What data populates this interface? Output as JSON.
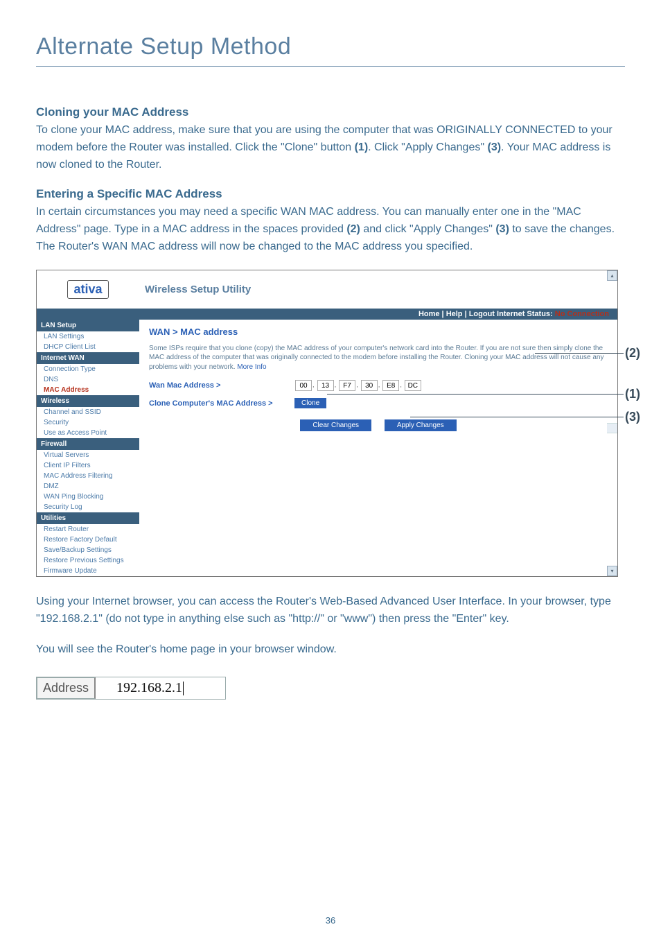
{
  "page": {
    "title": "Alternate Setup Method",
    "number": "36"
  },
  "section1": {
    "heading": "Cloning your MAC Address",
    "body_part1": "To clone your MAC address, make sure that you are using the computer that was ORIGINALLY CONNECTED to your modem before the Router was installed. Click the \"Clone\" button ",
    "bold1": "(1)",
    "body_part2": ". Click \"Apply Changes\" ",
    "bold2": "(3)",
    "body_part3": ". Your MAC address is now cloned to the Router."
  },
  "section2": {
    "heading": "Entering a Specific MAC Address",
    "body_part1": "In certain circumstances you may need a specific WAN MAC address. You can manually enter one in the \"MAC Address\" page. Type in a MAC address in the spaces provided ",
    "bold1": "(2)",
    "body_part2": " and click \"Apply Changes\" ",
    "bold2": "(3)",
    "body_part3": " to save the changes. The Router's WAN MAC address will now be changed to the MAC address you specified."
  },
  "router": {
    "logo": "ativa",
    "utility_title": "Wireless Setup Utility",
    "status_links": "Home | Help | Logout   Internet Status:",
    "status_value": "No Connection",
    "sidebar": {
      "lan_setup": {
        "cat": "LAN Setup",
        "items": [
          "LAN Settings",
          "DHCP Client List"
        ]
      },
      "internet_wan": {
        "cat": "Internet WAN",
        "items": [
          "Connection Type",
          "DNS",
          "MAC Address"
        ],
        "active_index": 2
      },
      "wireless": {
        "cat": "Wireless",
        "items": [
          "Channel and SSID",
          "Security",
          "Use as Access Point"
        ]
      },
      "firewall": {
        "cat": "Firewall",
        "items": [
          "Virtual Servers",
          "Client IP Filters",
          "MAC Address Filtering",
          "DMZ",
          "WAN Ping Blocking",
          "Security Log"
        ]
      },
      "utilities": {
        "cat": "Utilities",
        "items": [
          "Restart Router",
          "Restore Factory Default",
          "Save/Backup Settings",
          "Restore Previous Settings",
          "Firmware Update"
        ]
      }
    },
    "content": {
      "breadcrumb": "WAN > MAC address",
      "desc": "Some ISPs require that you clone (copy) the MAC address of your computer's network card into the Router. If you are not sure then simply clone the MAC address of the computer that was originally connected to the modem before installing the Router. Cloning your MAC address will not cause any problems with your network. ",
      "more": "More Info",
      "wan_mac_label": "Wan Mac Address >",
      "mac": [
        "00",
        "13",
        "F7",
        "30",
        "E8",
        "DC"
      ],
      "clone_label": "Clone Computer's MAC Address >",
      "btn_clone": "Clone",
      "btn_clear": "Clear Changes",
      "btn_apply": "Apply Changes"
    }
  },
  "callouts": {
    "c1": "(1)",
    "c2": "(2)",
    "c3": "(3)"
  },
  "paragraph3": "Using your Internet browser, you can access the Router's Web-Based Advanced User Interface. In your browser, type \"192.168.2.1\" (do not type in anything else such as \"http://\" or \"www\") then press the \"Enter\" key.",
  "paragraph4": "You will see the Router's home page in your browser window.",
  "address": {
    "label": "Address",
    "value": "192.168.2.1"
  }
}
